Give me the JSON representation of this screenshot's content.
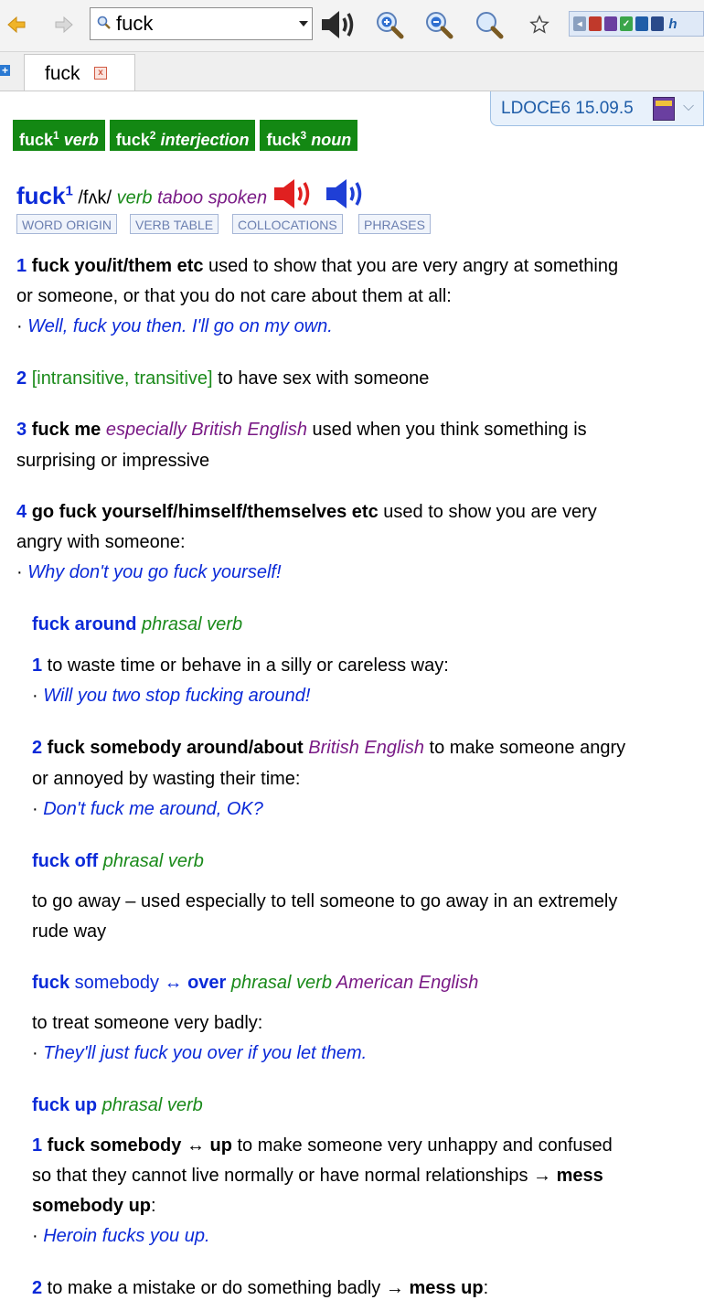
{
  "toolbar": {
    "search_value": "fuck"
  },
  "tab": {
    "label": "fuck",
    "close_glyph": "x"
  },
  "dictionary": {
    "name": "LDOCE6 15.09.5",
    "chevron": "⌵"
  },
  "headword_tabs": [
    {
      "word": "fuck",
      "num": "1",
      "pos": "verb"
    },
    {
      "word": "fuck",
      "num": "2",
      "pos": "interjection"
    },
    {
      "word": "fuck",
      "num": "3",
      "pos": "noun"
    }
  ],
  "entry": {
    "headword": "fuck",
    "hom": "1",
    "pron": "/fʌk/",
    "pos": "verb",
    "register": "taboo spoken",
    "buttons": [
      "WORD ORIGIN",
      "VERB TABLE",
      "COLLOCATIONS",
      "PHRASES"
    ],
    "senses": [
      {
        "num": "1",
        "phrase": "fuck you/it/them etc",
        "def_a": " used to show that you are very angry at something",
        "def_b": "or someone, or that you do not care about them at all:",
        "example": " Well, fuck you then. I'll go on my own."
      },
      {
        "num": "2",
        "grammar": "[intransitive, transitive]",
        "def": " to have sex with someone"
      },
      {
        "num": "3",
        "phrase": " fuck me",
        "geo": " especially British English",
        "def_a": " used when you think something is",
        "def_b": "surprising or impressive"
      },
      {
        "num": "4",
        "phrase": " go fuck yourself/himself/themselves etc",
        "def_a": " used to show you are very",
        "def_b": "angry with someone:",
        "example": " Why don't you go fuck yourself!"
      }
    ],
    "phrasal": [
      {
        "head": "fuck around",
        "tag": " phrasal verb",
        "senses": [
          {
            "num": "1",
            "def": " to waste time or behave in a silly or careless way:",
            "example": " Will you two stop fucking around!"
          },
          {
            "num": "2",
            "phrase": " fuck somebody around/about",
            "geo": " British English",
            "def_a": " to make someone angry",
            "def_b": "or annoyed by wasting their time:",
            "example": " Don't fuck me around, OK?"
          }
        ]
      },
      {
        "head": "fuck off",
        "tag": " phrasal verb",
        "def_a": "to go away – used especially to tell someone to go away in an extremely",
        "def_b": "rude way"
      },
      {
        "head_a": "fuck",
        "head_b": " somebody ↔ ",
        "head_c": "over",
        "tag": " phrasal verb",
        "geo": " American English",
        "def": "to treat someone very badly:",
        "example": " They'll just fuck you over if you let them."
      },
      {
        "head": "fuck up",
        "tag": " phrasal verb",
        "senses": [
          {
            "num": "1",
            "phrase": " fuck somebody ↔ up",
            "def_a": " to make someone very unhappy and confused",
            "def_b": "so that they cannot live normally or have normal relationships → ",
            "xref_b": "mess",
            "xref_c": "somebody up",
            "def_c": ":",
            "example": " Heroin fucks you up."
          },
          {
            "num": "2",
            "def": " to make a mistake or do something badly → ",
            "xref": "mess up",
            "tail": ":"
          }
        ]
      }
    ]
  },
  "bullet": "·"
}
